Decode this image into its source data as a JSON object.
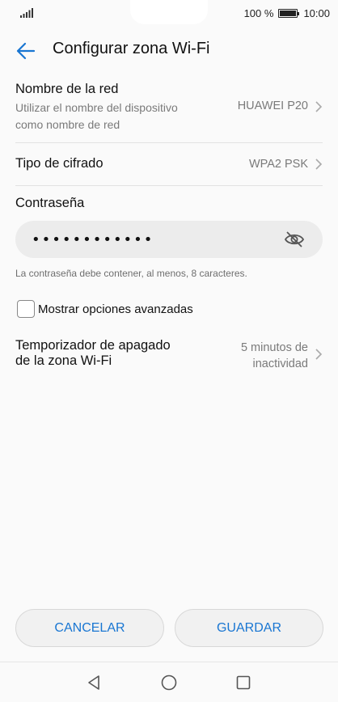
{
  "status_bar": {
    "battery_percent": "100 %",
    "time": "10:00"
  },
  "header": {
    "title": "Configurar zona Wi-Fi"
  },
  "network_name": {
    "title": "Nombre de la red",
    "subtitle_line1": "Utilizar el nombre del dispositivo",
    "subtitle_line2": "como nombre de red",
    "value": "HUAWEI P20"
  },
  "encryption": {
    "title": "Tipo de cifrado",
    "value": "WPA2 PSK"
  },
  "password": {
    "label": "Contraseña",
    "masked_value": "••••••••••••",
    "hint": "La contraseña debe contener, al menos, 8 caracteres."
  },
  "advanced": {
    "label": "Mostrar opciones avanzadas",
    "checked": false
  },
  "timer": {
    "title_line1": "Temporizador de apagado",
    "title_line2": "de la zona Wi-Fi",
    "value_line1": "5 minutos de",
    "value_line2": "inactividad"
  },
  "buttons": {
    "cancel": "CANCELAR",
    "save": "GUARDAR"
  },
  "colors": {
    "accent": "#1976d2",
    "background": "#fafafa"
  },
  "icons": {
    "back": "arrow-left-icon",
    "chevron": "chevron-right-icon",
    "eye": "eye-off-icon",
    "nav_back": "triangle-back-icon",
    "nav_home": "circle-home-icon",
    "nav_recents": "square-recents-icon"
  }
}
